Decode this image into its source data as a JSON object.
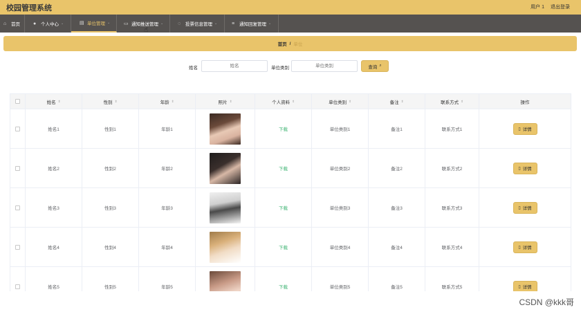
{
  "app": {
    "title": "校园管理系统",
    "user_label": "用户 1",
    "logout_label": "退出登录"
  },
  "nav": {
    "items": [
      {
        "label": "首页",
        "icon": "home-icon"
      },
      {
        "label": "个人中心",
        "icon": "user-icon"
      },
      {
        "label": "单位管理",
        "icon": "building-icon"
      },
      {
        "label": "通知推送管理",
        "icon": "message-icon"
      },
      {
        "label": "投票信息管理",
        "icon": "vote-icon"
      },
      {
        "label": "通知回复管理",
        "icon": "reply-icon"
      }
    ],
    "active_index": 2
  },
  "breadcrumb": {
    "home": "首页",
    "separator": "/",
    "current": "单位"
  },
  "search": {
    "name_label": "姓名",
    "name_placeholder": "姓名",
    "category_label": "单位类别",
    "category_placeholder": "单位类别",
    "button_label": "查询"
  },
  "table": {
    "columns": [
      "姓名",
      "性别",
      "年龄",
      "照片",
      "个人资料",
      "单位类别",
      "备注",
      "联系方式",
      "操作"
    ],
    "rows": [
      {
        "name": "姓名1",
        "gender": "性别1",
        "age": "年龄1",
        "profile": "下载",
        "category": "单位类别1",
        "remark": "备注1",
        "contact": "联系方式1",
        "action": "详情"
      },
      {
        "name": "姓名2",
        "gender": "性别2",
        "age": "年龄2",
        "profile": "下载",
        "category": "单位类别2",
        "remark": "备注2",
        "contact": "联系方式2",
        "action": "详情"
      },
      {
        "name": "姓名3",
        "gender": "性别3",
        "age": "年龄3",
        "profile": "下载",
        "category": "单位类别3",
        "remark": "备注3",
        "contact": "联系方式3",
        "action": "详情"
      },
      {
        "name": "姓名4",
        "gender": "性别4",
        "age": "年龄4",
        "profile": "下载",
        "category": "单位类别4",
        "remark": "备注4",
        "contact": "联系方式4",
        "action": "详情"
      },
      {
        "name": "姓名5",
        "gender": "性别5",
        "age": "年龄5",
        "profile": "下载",
        "category": "单位类别5",
        "remark": "备注5",
        "contact": "联系方式5",
        "action": "详情"
      }
    ]
  },
  "watermark": "CSDN @kkk哥",
  "colors": {
    "accent": "#e9c46a",
    "nav_bg": "#555250",
    "download": "#3cb371"
  }
}
